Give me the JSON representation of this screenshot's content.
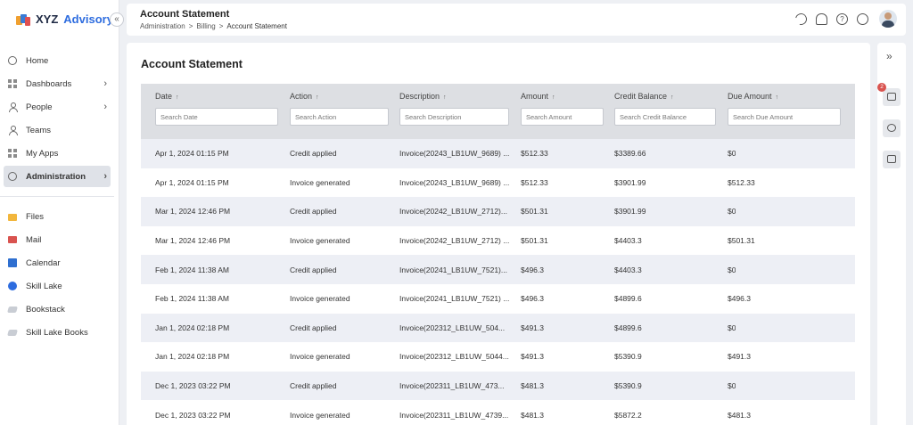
{
  "brand": {
    "name_part1": "XYZ",
    "name_part2": "Advisory",
    "collapse_glyph": "«"
  },
  "nav": {
    "items": [
      {
        "label": "Home",
        "icon": "home-icon",
        "chevron": false
      },
      {
        "label": "Dashboards",
        "icon": "dashboard-icon",
        "chevron": true
      },
      {
        "label": "People",
        "icon": "people-icon",
        "chevron": true
      },
      {
        "label": "Teams",
        "icon": "teams-icon",
        "chevron": false
      },
      {
        "label": "My Apps",
        "icon": "apps-icon",
        "chevron": false
      },
      {
        "label": "Administration",
        "icon": "gear-icon",
        "chevron": true,
        "active": true
      }
    ],
    "apps": [
      {
        "label": "Files",
        "icon": "folder-icon"
      },
      {
        "label": "Mail",
        "icon": "mail-icon"
      },
      {
        "label": "Calendar",
        "icon": "calendar-icon"
      },
      {
        "label": "Skill Lake",
        "icon": "globe-icon"
      },
      {
        "label": "Bookstack",
        "icon": "book-icon"
      },
      {
        "label": "Skill Lake Books",
        "icon": "book-icon"
      }
    ],
    "chevron_glyph": "›"
  },
  "header": {
    "title": "Account Statement",
    "breadcrumb": [
      "Administration",
      "Billing",
      "Account Statement"
    ],
    "breadcrumb_sep": ">",
    "help_glyph": "?"
  },
  "card": {
    "title": "Account Statement"
  },
  "table": {
    "sort_glyph": "↑",
    "columns": [
      {
        "label": "Date",
        "placeholder": "Search Date"
      },
      {
        "label": "Action",
        "placeholder": "Search Action"
      },
      {
        "label": "Description",
        "placeholder": "Search Description"
      },
      {
        "label": "Amount",
        "placeholder": "Search Amount"
      },
      {
        "label": "Credit Balance",
        "placeholder": "Search Credit Balance"
      },
      {
        "label": "Due Amount",
        "placeholder": "Search Due Amount"
      }
    ],
    "rows": [
      [
        "Apr 1, 2024 01:15 PM",
        "Credit applied",
        "Invoice(20243_LB1UW_9689) ...",
        "$512.33",
        "$3389.66",
        "$0"
      ],
      [
        "Apr 1, 2024 01:15 PM",
        "Invoice generated",
        "Invoice(20243_LB1UW_9689) ...",
        "$512.33",
        "$3901.99",
        "$512.33"
      ],
      [
        "Mar 1, 2024 12:46 PM",
        "Credit applied",
        "Invoice(20242_LB1UW_2712)...",
        "$501.31",
        "$3901.99",
        "$0"
      ],
      [
        "Mar 1, 2024 12:46 PM",
        "Invoice generated",
        "Invoice(20242_LB1UW_2712) ...",
        "$501.31",
        "$4403.3",
        "$501.31"
      ],
      [
        "Feb 1, 2024 11:38 AM",
        "Credit applied",
        "Invoice(20241_LB1UW_7521)...",
        "$496.3",
        "$4403.3",
        "$0"
      ],
      [
        "Feb 1, 2024 11:38 AM",
        "Invoice generated",
        "Invoice(20241_LB1UW_7521) ...",
        "$496.3",
        "$4899.6",
        "$496.3"
      ],
      [
        "Jan 1, 2024 02:18 PM",
        "Credit applied",
        "Invoice(202312_LB1UW_504...",
        "$491.3",
        "$4899.6",
        "$0"
      ],
      [
        "Jan 1, 2024 02:18 PM",
        "Invoice generated",
        "Invoice(202312_LB1UW_5044...",
        "$491.3",
        "$5390.9",
        "$491.3"
      ],
      [
        "Dec 1, 2023 03:22 PM",
        "Credit applied",
        "Invoice(202311_LB1UW_473...",
        "$481.3",
        "$5390.9",
        "$0"
      ],
      [
        "Dec 1, 2023 03:22 PM",
        "Invoice generated",
        "Invoice(202311_LB1UW_4739...",
        "$481.3",
        "$5872.2",
        "$481.3"
      ]
    ]
  },
  "right_panel": {
    "expand_glyph": "»",
    "badge_count": "2"
  },
  "colors": {
    "accent": "#2d6cdf",
    "badge": "#d9534f",
    "row_alt": "#edeff5",
    "header_bg": "#dddfe3"
  }
}
